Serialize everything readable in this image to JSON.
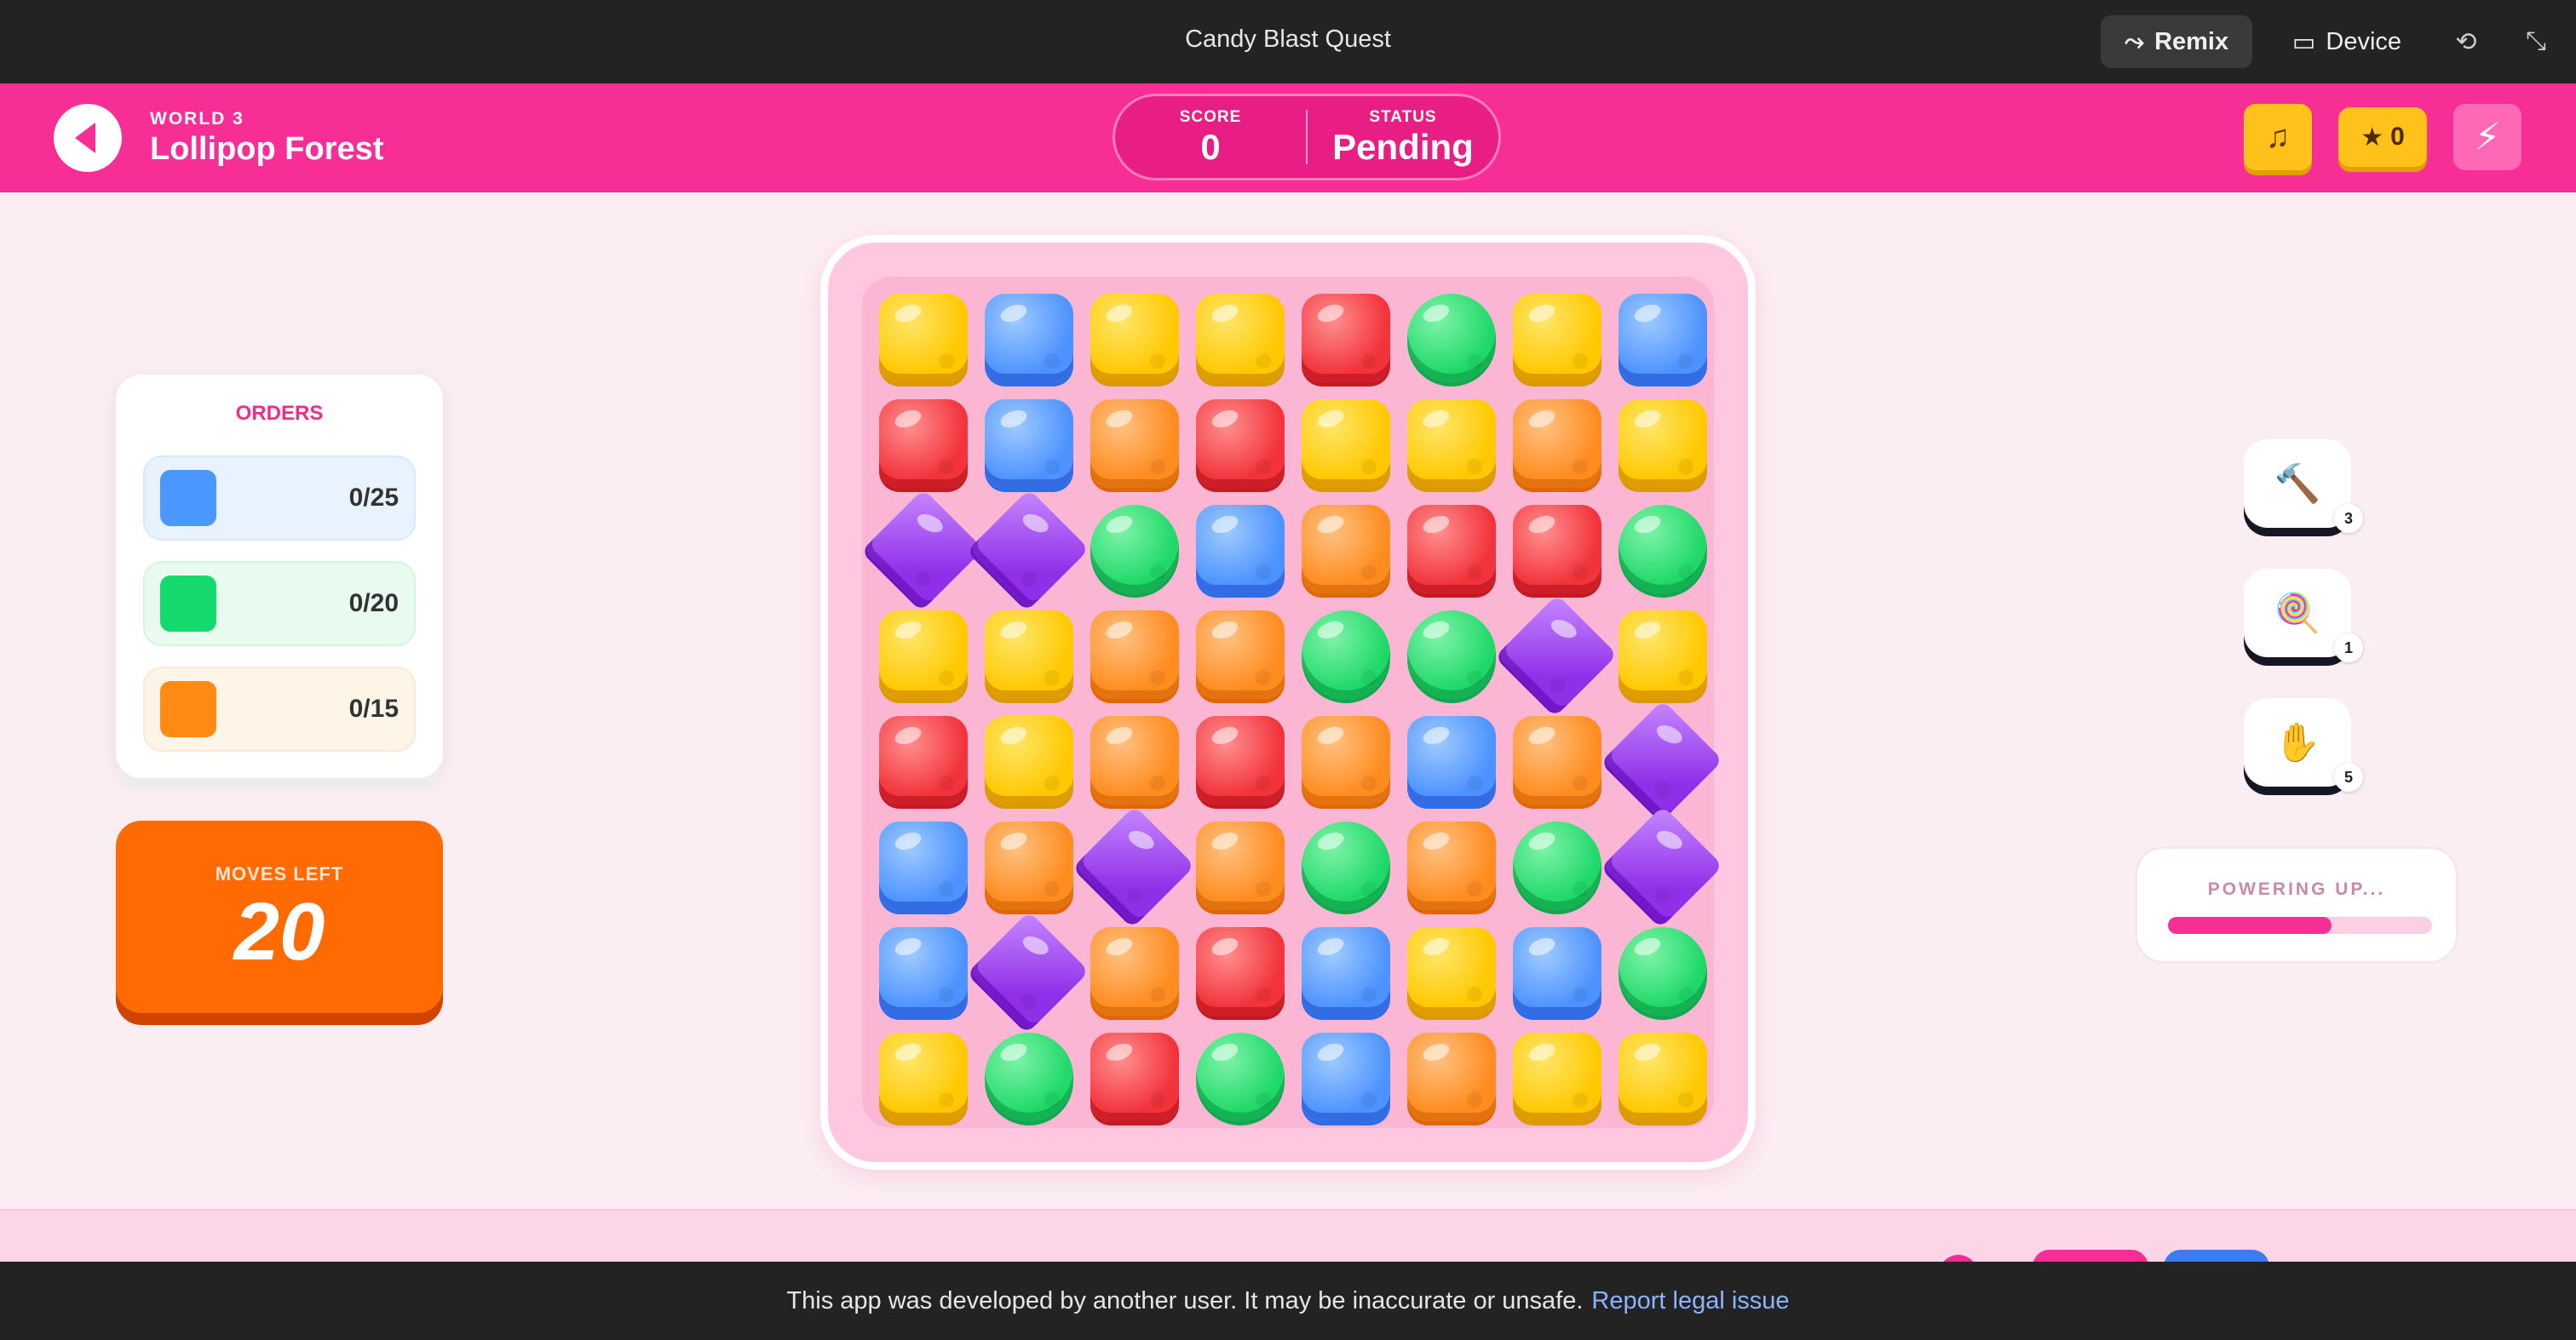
{
  "topbar": {
    "title": "Candy Blast Quest",
    "remix_label": "Remix",
    "device_label": "Device",
    "remix_icon": "remix-icon",
    "device_icon": "device-icon",
    "refresh_icon": "refresh-icon",
    "fullscreen_icon": "fullscreen-icon"
  },
  "header": {
    "world": "WORLD 3",
    "level_name": "Lollipop Forest",
    "score_label": "SCORE",
    "score_value": "0",
    "status_label": "STATUS",
    "status_value": "Pending",
    "stars_count": "0",
    "accent": "#f72e95"
  },
  "orders": {
    "title": "ORDERS",
    "items": [
      {
        "color": "blue",
        "progress": "0/25"
      },
      {
        "color": "green",
        "progress": "0/20"
      },
      {
        "color": "orange",
        "progress": "0/15"
      }
    ]
  },
  "moves": {
    "label": "MOVES LEFT",
    "value": "20"
  },
  "board": {
    "rows": [
      [
        "yellow",
        "blue",
        "yellow",
        "yellow",
        "red",
        "green",
        "yellow",
        "blue"
      ],
      [
        "red",
        "blue",
        "orange",
        "red",
        "yellow",
        "yellow",
        "orange",
        "yellow"
      ],
      [
        "purple",
        "purple",
        "green",
        "blue",
        "orange",
        "red",
        "red",
        "green"
      ],
      [
        "yellow",
        "yellow",
        "orange",
        "orange",
        "green",
        "green",
        "purple",
        "yellow"
      ],
      [
        "red",
        "yellow",
        "orange",
        "red",
        "orange",
        "blue",
        "orange",
        "purple"
      ],
      [
        "blue",
        "orange",
        "purple",
        "orange",
        "green",
        "orange",
        "green",
        "purple"
      ],
      [
        "blue",
        "purple",
        "orange",
        "red",
        "blue",
        "yellow",
        "blue",
        "green"
      ],
      [
        "yellow",
        "green",
        "red",
        "green",
        "blue",
        "orange",
        "yellow",
        "yellow"
      ]
    ]
  },
  "tools": [
    {
      "icon": "hammer-icon",
      "glyph": "🔨",
      "count": "3"
    },
    {
      "icon": "lollipop-icon",
      "glyph": "🍭",
      "count": "1"
    },
    {
      "icon": "hand-icon",
      "glyph": "✋",
      "count": "5"
    }
  ],
  "power": {
    "label": "POWERING UP...",
    "progress": 0.62
  },
  "footer": {
    "text": "This app was developed by another user. It may be inaccurate or unsafe.",
    "link": "Report legal issue"
  }
}
